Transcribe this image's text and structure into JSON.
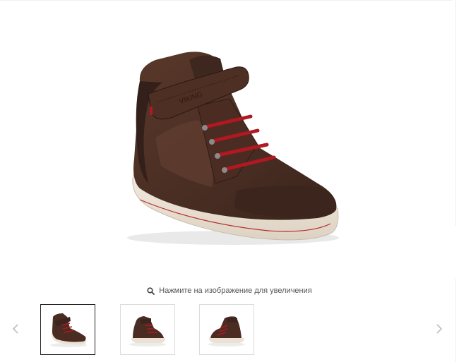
{
  "gallery": {
    "zoom_hint": "Нажмите на изображение для увеличения",
    "prev_icon": "chevron-left-icon",
    "next_icon": "chevron-right-icon",
    "zoom_icon": "search-icon",
    "active_thumbnail": 1,
    "thumbnail_count": 3,
    "shoe_brand_mark": "VIKING",
    "colors": {
      "leather": "#4a2c22",
      "leather_dark": "#33201a",
      "suede": "#5a3a2e",
      "laces": "#b01822",
      "sole": "#ece3d6",
      "sole_stripe": "#b52a2a",
      "thumb_active_border": "#222222",
      "thumb_border": "#dcdcdc",
      "arrow": "#bdbdbd",
      "hint_text": "#555555"
    }
  }
}
